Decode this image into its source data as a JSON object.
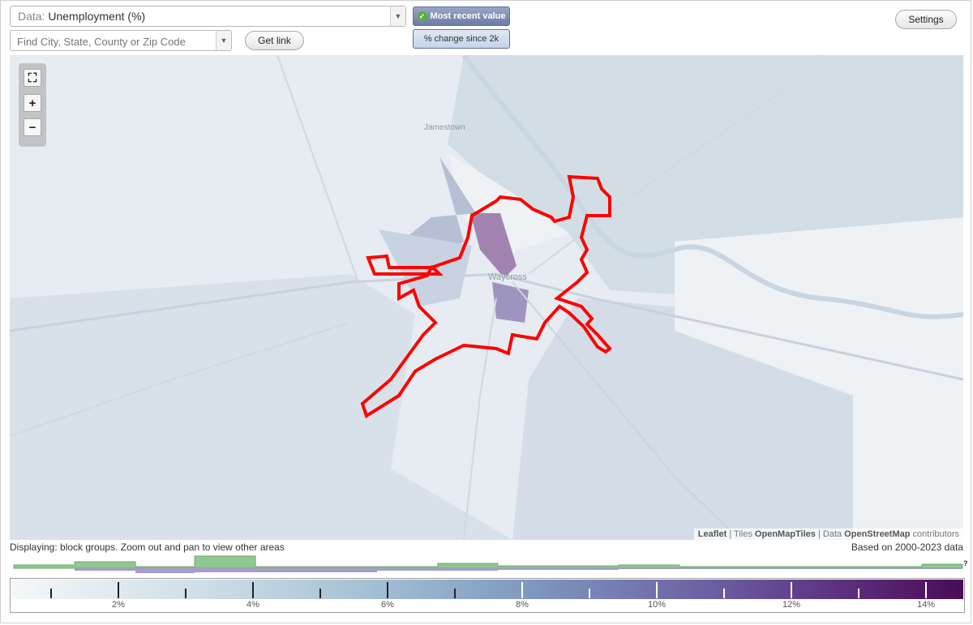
{
  "data_select": {
    "prefix": "Data:",
    "value": "Unemployment (%)"
  },
  "location_search": {
    "placeholder": "Find City, State, County or Zip Code"
  },
  "get_link_label": "Get link",
  "mode_buttons": {
    "most_recent": "Most recent value",
    "pct_change": "% change since 2k"
  },
  "settings_label": "Settings",
  "map": {
    "places": {
      "jamestown": "Jamestown",
      "waycross": "Waycross"
    },
    "attribution": {
      "leaflet": "Leaflet",
      "sep1": " | Tiles ",
      "tiles": "OpenMapTiles",
      "sep2": " | Data ",
      "data": "OpenStreetMap",
      "suffix": " contributors"
    }
  },
  "displaying_text": "Displaying: block groups. Zoom out and pan to view other areas",
  "based_on_text": "Based on 2000-2023 data",
  "histogram_help": "?",
  "legend": {
    "tick_labels": [
      "2%",
      "4%",
      "6%",
      "8%",
      "10%",
      "12%",
      "14%"
    ],
    "colors": {
      "low": "#f4f8f9",
      "mid": "#a3bfd4",
      "high": "#4a0c55"
    }
  },
  "colors": {
    "city_outline": "#ff0000",
    "highlight_purple": "#8a5f9a",
    "histogram_green": "#90c890",
    "histogram_purple": "#a79ccd"
  }
}
